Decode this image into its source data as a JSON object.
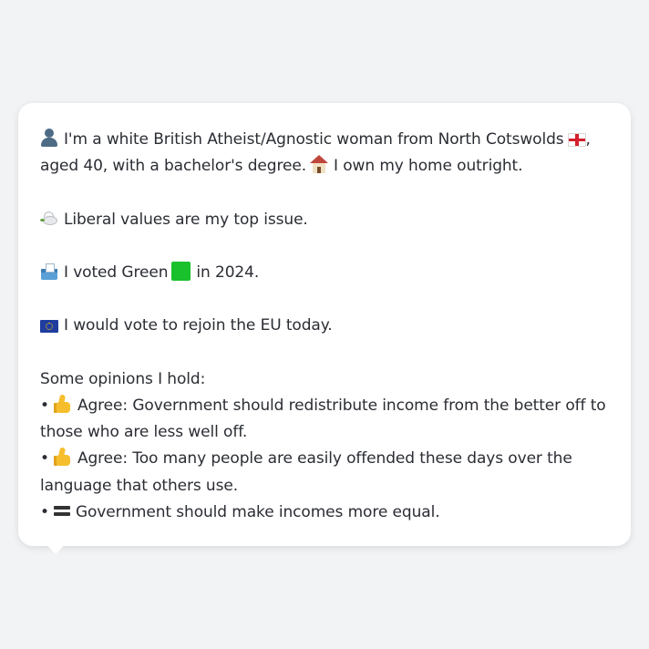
{
  "profile": {
    "line1_text": "I'm a white British Atheist/Agnostic woman from North Cotswolds",
    "line1_suffix": ",",
    "line2_text": "aged 40, with a bachelor's degree.",
    "line2_suffix": "I own my home outright.",
    "top_issue": "Liberal values are my top issue.",
    "vote_prefix": "I voted Green",
    "vote_suffix": "in 2024.",
    "eu_text": "I would vote to rejoin the EU today."
  },
  "opinions": {
    "heading": "Some opinions I hold:",
    "bullet": "•",
    "items": [
      {
        "icon": "thumbs-up-icon",
        "line1": "Agree: Government should redistribute income from the better off to",
        "line2": "those who are less well off."
      },
      {
        "icon": "thumbs-up-icon",
        "line1": "Agree: Too many people are easily offended these days over the",
        "line2": "language that others use."
      },
      {
        "icon": "equals-icon",
        "line1": "Government should make incomes more equal."
      }
    ]
  },
  "colors": {
    "background": "#f1f3f5",
    "bubble": "#ffffff",
    "text": "#2a2d33",
    "green_square": "#19c12d"
  }
}
